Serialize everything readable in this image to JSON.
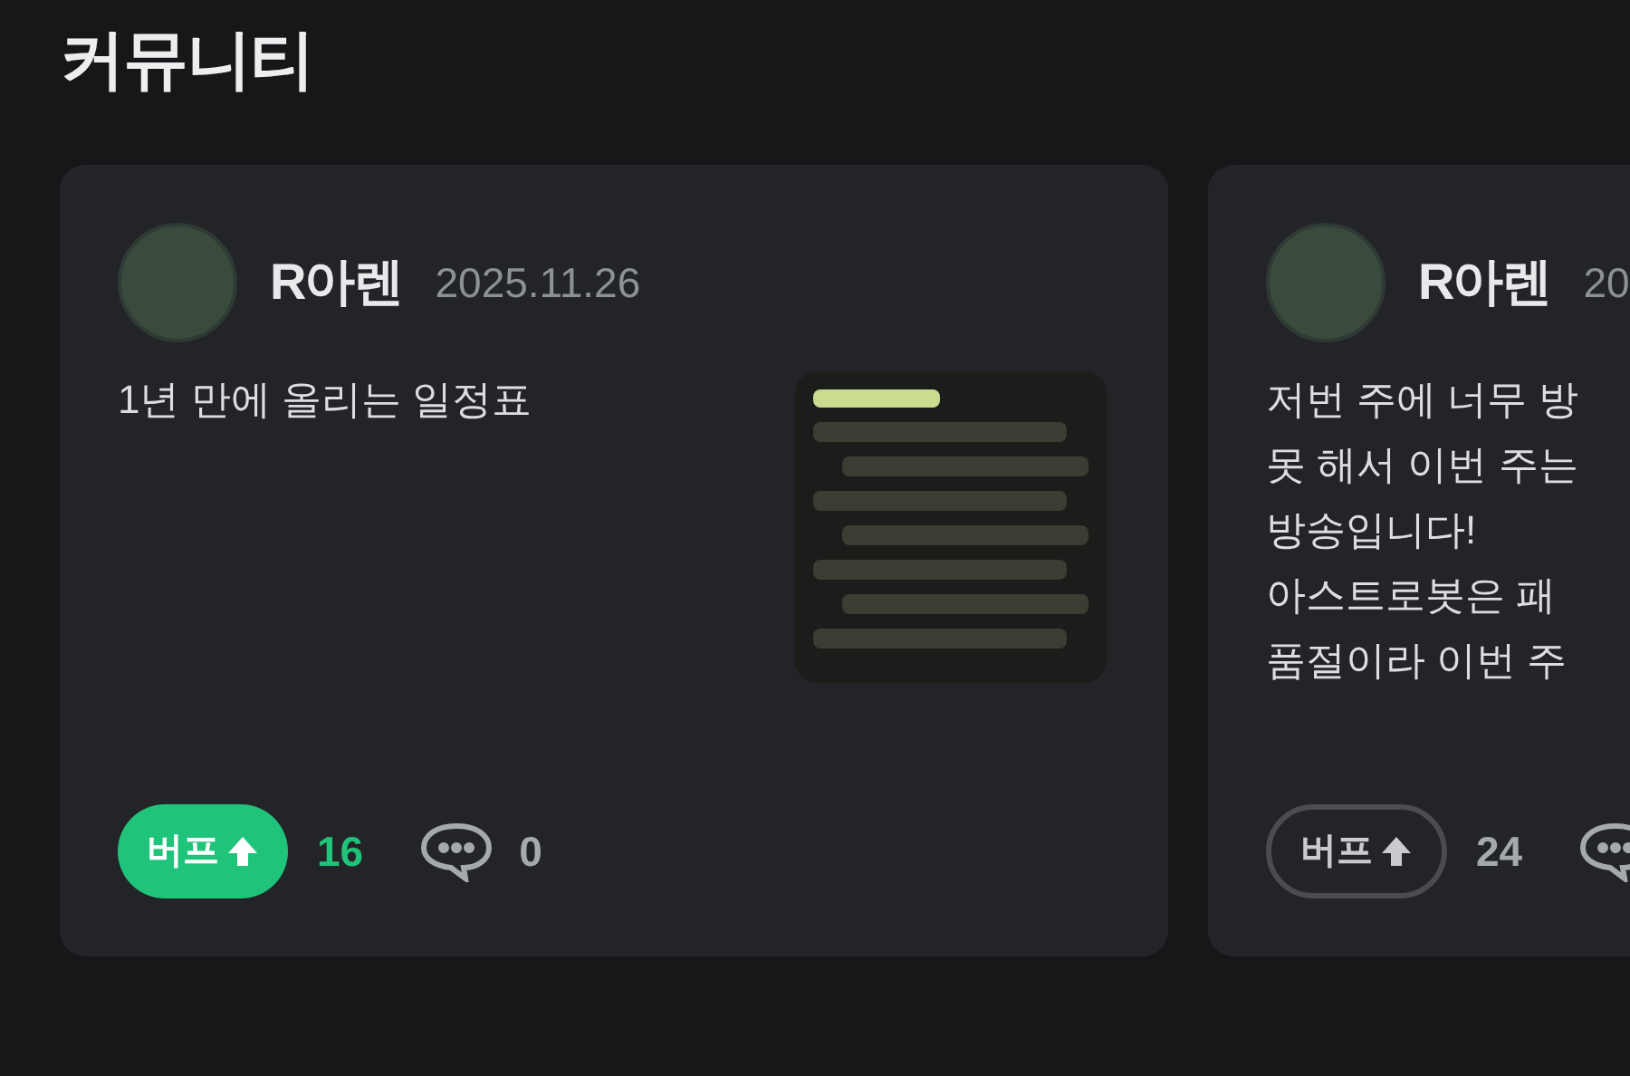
{
  "heading": "커뮤니티",
  "posts": [
    {
      "author": "R아렌",
      "date": "2025.11.26",
      "lines": [
        "1년 만에 올리는 일정표"
      ],
      "has_image": true,
      "buff_label": "버프",
      "buffed": true,
      "buff_count": "16",
      "comment_count": "0"
    },
    {
      "author": "R아렌",
      "date": "20",
      "lines": [
        "저번 주에 너무 방",
        "못 해서 이번 주는",
        "방송입니다!",
        "아스트로봇은 패",
        "품절이라 이번 주"
      ],
      "has_image": false,
      "buff_label": "버프",
      "buffed": false,
      "buff_count": "24"
    }
  ]
}
